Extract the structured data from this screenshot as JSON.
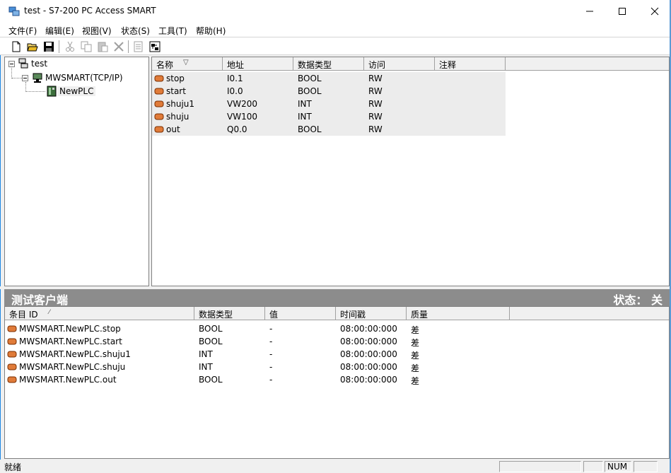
{
  "window": {
    "title": "test - S7-200 PC Access SMART"
  },
  "menu": [
    "文件(F)",
    "编辑(E)",
    "视图(V)",
    "状态(S)",
    "工具(T)",
    "帮助(H)"
  ],
  "toolbar": [
    "new-icon",
    "open-icon",
    "save-icon",
    "cut-icon",
    "copy-icon",
    "paste-icon",
    "delete-icon",
    "properties-icon",
    "test-client-icon"
  ],
  "tree": {
    "root": "test",
    "channel": "MWSMART(TCP/IP)",
    "plc": "NewPLC"
  },
  "items": {
    "columns": [
      "名称",
      "地址",
      "数据类型",
      "访问",
      "注释"
    ],
    "rows": [
      {
        "name": "stop",
        "address": "I0.1",
        "type": "BOOL",
        "access": "RW",
        "comment": ""
      },
      {
        "name": "start",
        "address": "I0.0",
        "type": "BOOL",
        "access": "RW",
        "comment": ""
      },
      {
        "name": "shuju1",
        "address": "VW200",
        "type": "INT",
        "access": "RW",
        "comment": ""
      },
      {
        "name": "shuju",
        "address": "VW100",
        "type": "INT",
        "access": "RW",
        "comment": ""
      },
      {
        "name": "out",
        "address": "Q0.0",
        "type": "BOOL",
        "access": "RW",
        "comment": ""
      }
    ]
  },
  "client": {
    "title": "测试客户端",
    "status": "状态： 关",
    "columns": [
      "条目 ID",
      "数据类型",
      "值",
      "时间戳",
      "质量"
    ],
    "rows": [
      {
        "id": "MWSMART.NewPLC.stop",
        "type": "BOOL",
        "value": "-",
        "timestamp": "08:00:00:000",
        "quality": "差"
      },
      {
        "id": "MWSMART.NewPLC.start",
        "type": "BOOL",
        "value": "-",
        "timestamp": "08:00:00:000",
        "quality": "差"
      },
      {
        "id": "MWSMART.NewPLC.shuju1",
        "type": "INT",
        "value": "-",
        "timestamp": "08:00:00:000",
        "quality": "差"
      },
      {
        "id": "MWSMART.NewPLC.shuju",
        "type": "INT",
        "value": "-",
        "timestamp": "08:00:00:000",
        "quality": "差"
      },
      {
        "id": "MWSMART.NewPLC.out",
        "type": "BOOL",
        "value": "-",
        "timestamp": "08:00:00:000",
        "quality": "差"
      }
    ]
  },
  "status": {
    "text": "就绪",
    "num": "NUM"
  },
  "colors": {
    "header_bar": "#8c8c8c",
    "tag_icon": "#d2691e",
    "window_bg": "#f0f0f0"
  }
}
